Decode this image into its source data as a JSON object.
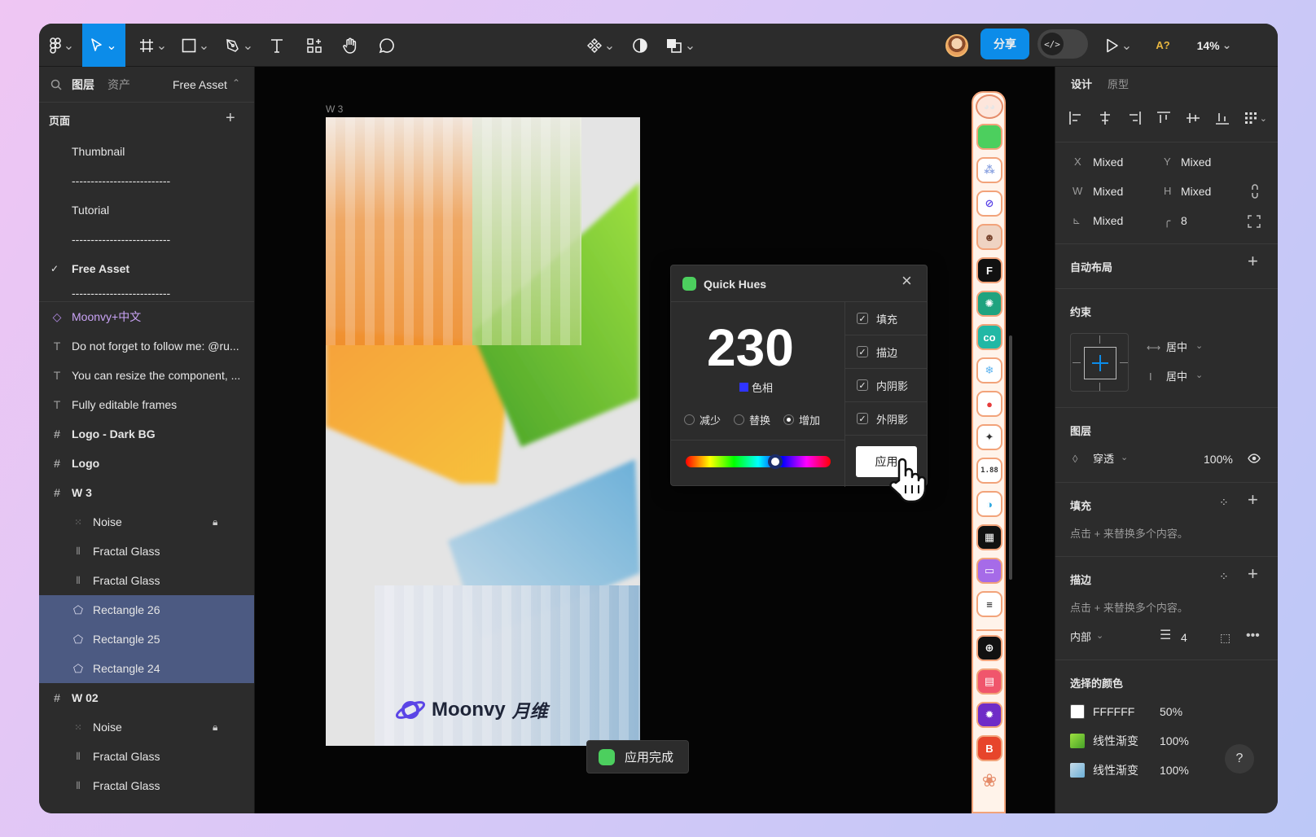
{
  "toolbar": {
    "share_label": "分享",
    "zoom": "14%",
    "code_label": "</>",
    "ai_label": "A?"
  },
  "left": {
    "tabs": {
      "layers": "图层",
      "assets": "资产",
      "page_selector": "Free Asset"
    },
    "pages_title": "页面",
    "pages": [
      {
        "label": "Thumbnail"
      },
      {
        "label": "--------------------------"
      },
      {
        "label": "Tutorial"
      },
      {
        "label": "--------------------------"
      },
      {
        "label": "Free Asset"
      },
      {
        "label": "--------------------------"
      }
    ],
    "layers": [
      {
        "label": "Moonvy+中文"
      },
      {
        "label": "Do not forget to follow me: @ru..."
      },
      {
        "label": "You can resize the component, ..."
      },
      {
        "label": "Fully editable frames"
      },
      {
        "label": "Logo - Dark BG"
      },
      {
        "label": "Logo"
      },
      {
        "label": "W 3"
      },
      {
        "label": "Noise"
      },
      {
        "label": "Fractal Glass"
      },
      {
        "label": "Fractal Glass"
      },
      {
        "label": "Rectangle 26"
      },
      {
        "label": "Rectangle 25"
      },
      {
        "label": "Rectangle 24"
      },
      {
        "label": "W 02"
      },
      {
        "label": "Noise"
      },
      {
        "label": "Fractal Glass"
      },
      {
        "label": "Fractal Glass"
      }
    ]
  },
  "canvas": {
    "frame_label": "W 3",
    "brand_en": "Moonvy",
    "brand_cn": "月维",
    "toast": "应用完成"
  },
  "plugin": {
    "title": "Quick Hues",
    "value": "230",
    "mode_label": "色相",
    "mode_color": "#2f34ff",
    "radios": [
      "减少",
      "替换",
      "增加"
    ],
    "radio_selected": "增加",
    "checks": [
      "填充",
      "描边",
      "内阴影",
      "外阴影"
    ],
    "apply": "应用",
    "hue_level": 0.62
  },
  "right": {
    "tabs": {
      "design": "设计",
      "prototype": "原型"
    },
    "x_label": "X",
    "x": "Mixed",
    "y_label": "Y",
    "y": "Mixed",
    "w_label": "W",
    "w": "Mixed",
    "h_label": "H",
    "h": "Mixed",
    "rot": "Mixed",
    "radius": "8",
    "autolayout": "自动布局",
    "constraints": "约束",
    "constraint_h": "居中",
    "constraint_v": "居中",
    "layer_title": "图层",
    "blend": "穿透",
    "opacity": "100%",
    "fill_title": "填充",
    "fill_hint": "点击 + 来替换多个内容。",
    "stroke_title": "描边",
    "stroke_hint": "点击 + 来替换多个内容。",
    "stroke_pos": "内部",
    "stroke_weight": "4",
    "sel_colors_title": "选择的颜色",
    "sel_colors": [
      {
        "name": "FFFFFF",
        "pct": "50%",
        "swatch": "#ffffff"
      },
      {
        "name": "线性渐变",
        "pct": "100%",
        "swatch": "#7bbf34"
      },
      {
        "name": "线性渐变",
        "pct": "100%",
        "swatch": "#8fb3cf"
      }
    ],
    "help": "?"
  }
}
